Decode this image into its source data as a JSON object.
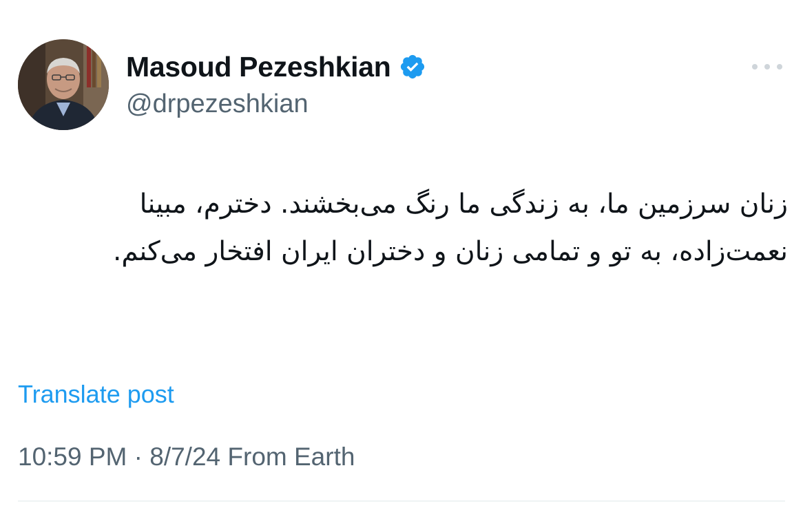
{
  "author": {
    "display_name": "Masoud Pezeshkian",
    "handle": "@drpezeshkian",
    "verified": true,
    "verified_color": "#1d9bf0"
  },
  "post": {
    "text": "زنان سرزمین ما، به زندگی ما رنگ می‌بخشند. دخترم، مبینا نعمت‌زاده، به تو و تمامی زنان و دختران ایران افتخار می‌کنم.",
    "translate_label": "Translate post",
    "timestamp": "10:59 PM · 8/7/24 From Earth"
  },
  "icons": {
    "more": "more-horizontal-icon",
    "verified": "verified-badge-icon"
  },
  "colors": {
    "link": "#1d9bf0",
    "secondary_text": "#536471",
    "primary_text": "#0f1419"
  }
}
